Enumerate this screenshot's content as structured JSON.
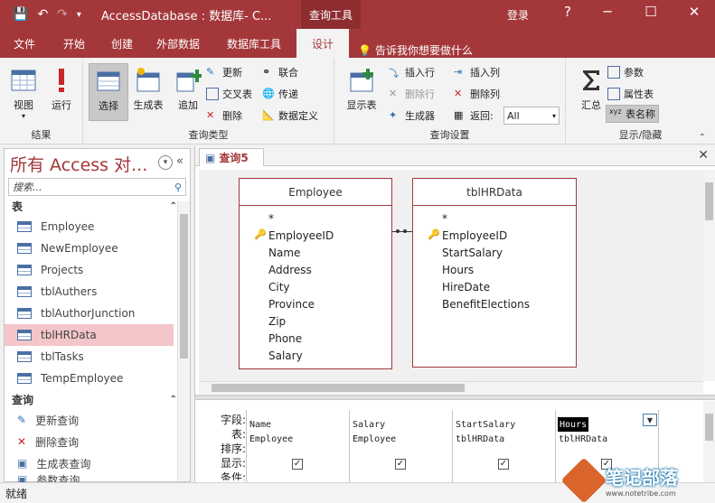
{
  "titlebar": {
    "title": "AccessDatabase : 数据库- C...",
    "context_tab": "查询工具",
    "login": "登录",
    "help": "?",
    "minimize": "─",
    "maximize": "☐",
    "close": "✕",
    "save_icon": "💾",
    "undo_icon": "↶",
    "redo_icon": "↷",
    "customize_icon": "▾"
  },
  "ribbon_tabs": [
    "文件",
    "开始",
    "创建",
    "外部数据",
    "数据库工具",
    "设计"
  ],
  "tellme": "告诉我你想要做什么",
  "ribbon": {
    "results": {
      "label": "结果",
      "view": "视图",
      "run": "运行"
    },
    "query_type": {
      "label": "查询类型",
      "select": "选择",
      "make_table": "生成表",
      "append": "追加",
      "update": "更新",
      "crosstab": "交叉表",
      "delete": "删除",
      "union": "联合",
      "pass_through": "传递",
      "data_definition": "数据定义"
    },
    "query_setup": {
      "label": "查询设置",
      "show_table": "显示表",
      "insert_row": "插入行",
      "delete_row": "删除行",
      "builder": "生成器",
      "insert_column": "插入列",
      "delete_column": "删除列",
      "return": "返回:",
      "return_value": "All"
    },
    "show_hide": {
      "label": "显示/隐藏",
      "totals": "汇总",
      "parameters": "参数",
      "property_sheet": "属性表",
      "table_names": "表名称"
    }
  },
  "nav": {
    "title": "所有 Access 对...",
    "search_placeholder": "搜索...",
    "tables_section": "表",
    "tables": [
      "Employee",
      "NewEmployee",
      "Projects",
      "tblAuthers",
      "tblAuthorJunction",
      "tblHRData",
      "tblTasks",
      "TempEmployee"
    ],
    "queries_section": "查询",
    "queries": [
      "更新查询",
      "删除查询",
      "生成表查询",
      "参数查询"
    ]
  },
  "doc": {
    "tab_label": "查询5",
    "tables": [
      {
        "name": "Employee",
        "fields": [
          "*",
          "EmployeeID",
          "Name",
          "Address",
          "City",
          "Province",
          "Zip",
          "Phone",
          "Salary"
        ],
        "key_field": 1
      },
      {
        "name": "tblHRData",
        "fields": [
          "*",
          "EmployeeID",
          "StartSalary",
          "Hours",
          "HireDate",
          "BenefitElections"
        ],
        "key_field": 1
      }
    ],
    "grid": {
      "row_labels": [
        "字段:",
        "表:",
        "排序:",
        "显示:",
        "条件:"
      ],
      "columns": [
        {
          "field": "Name",
          "table": "Employee",
          "show": true
        },
        {
          "field": "Salary",
          "table": "Employee",
          "show": true
        },
        {
          "field": "StartSalary",
          "table": "tblHRData",
          "show": true
        },
        {
          "field": "Hours",
          "table": "tblHRData",
          "show": true
        }
      ]
    }
  },
  "status": "就绪",
  "watermark": {
    "title": "笔记部落",
    "url": "www.notetribe.com"
  }
}
